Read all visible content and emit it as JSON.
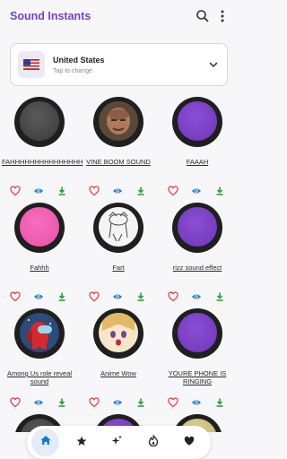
{
  "app": {
    "title": "Sound Instants"
  },
  "country": {
    "name": "United States",
    "hint": "Tap to change"
  },
  "colors": {
    "accent": "#7b3fc4",
    "heart": "#e2443d",
    "eye": "#1e78c8",
    "download": "#2e9e3e",
    "gray_button": "#4a4a4a",
    "purple_button": "#6f35b8",
    "pink_button": "#ec4fa8"
  },
  "sounds": [
    {
      "label": "FAHHHHHHHHHHHHHHH",
      "style": "gray"
    },
    {
      "label": "VINE BOOM SOUND",
      "style": "photo-face"
    },
    {
      "label": "FAAAH",
      "style": "purple"
    },
    {
      "label": "Fahhh",
      "style": "pink"
    },
    {
      "label": "Fart",
      "style": "sketch"
    },
    {
      "label": "rizz sound effect",
      "style": "purple"
    },
    {
      "label": "Among Us role reveal sound",
      "style": "amongus"
    },
    {
      "label": "Anime Wow",
      "style": "anime"
    },
    {
      "label": "YOURE PHONE IS RINGING",
      "style": "purple"
    }
  ],
  "actions": {
    "favorite": "heart-icon",
    "preview": "eye-icon",
    "download": "download-icon"
  },
  "nav": [
    {
      "name": "home",
      "icon": "home-icon",
      "active": true
    },
    {
      "name": "favorites",
      "icon": "star-icon",
      "active": false
    },
    {
      "name": "new",
      "icon": "sparkle-icon",
      "active": false
    },
    {
      "name": "trending",
      "icon": "flame-icon",
      "active": false
    },
    {
      "name": "liked",
      "icon": "heart-icon",
      "active": false
    }
  ]
}
